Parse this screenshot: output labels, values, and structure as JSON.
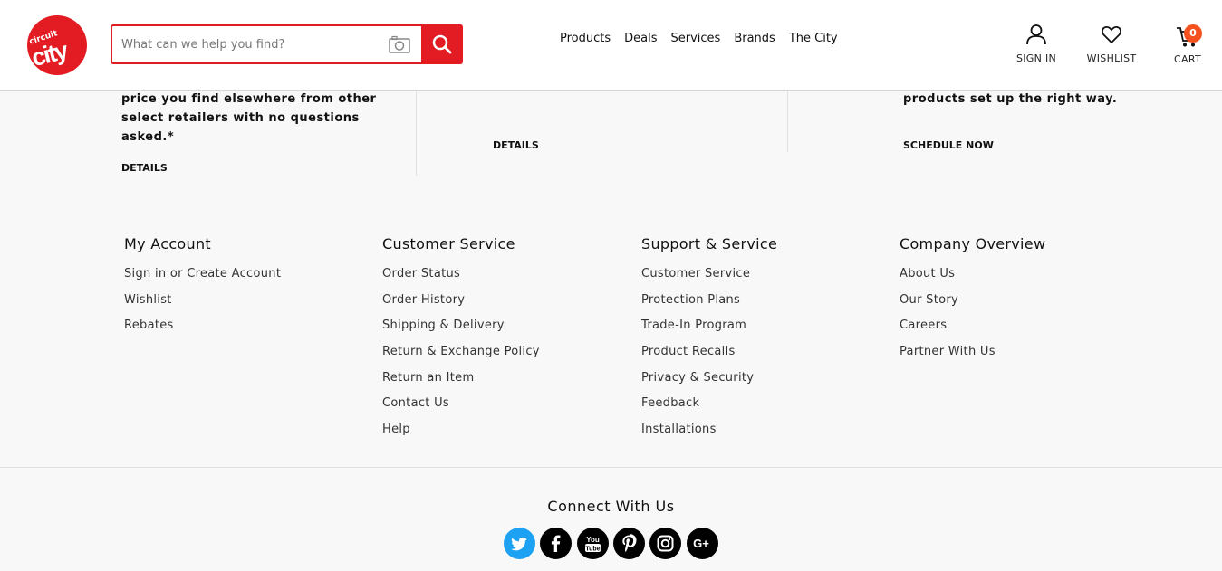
{
  "header": {
    "logo_top": "circuit",
    "logo_main": "city",
    "search_placeholder": "What can we help you find?",
    "nav": [
      "Products",
      "Deals",
      "Services",
      "Brands",
      "The City"
    ],
    "signin_label": "SIGN IN",
    "wishlist_label": "WISHLIST",
    "cart_label": "CART",
    "cart_count": "0"
  },
  "promos": [
    {
      "text_lines": [
        "price you find elsewhere from other",
        "select retailers with no questions",
        "asked.*"
      ],
      "link": "DETAILS"
    },
    {
      "text_lines": [],
      "link": "DETAILS"
    },
    {
      "text_lines": [
        "products set up the right way."
      ],
      "link": "SCHEDULE NOW"
    }
  ],
  "footer": {
    "columns": [
      {
        "title": "My Account",
        "items": [
          "Sign in or Create Account",
          "Wishlist",
          "Rebates"
        ]
      },
      {
        "title": "Customer Service",
        "items": [
          "Order Status",
          "Order History",
          "Shipping & Delivery",
          "Return & Exchange Policy",
          "Return an Item",
          "Contact Us",
          "Help"
        ]
      },
      {
        "title": "Support & Service",
        "items": [
          "Customer Service",
          "Protection Plans",
          "Trade-In Program",
          "Product Recalls",
          "Privacy & Security",
          "Feedback",
          "Installations"
        ]
      },
      {
        "title": "Company Overview",
        "items": [
          "About Us",
          "Our Story",
          "Careers",
          "Partner With Us"
        ]
      }
    ],
    "connect_title": "Connect With Us",
    "social": [
      {
        "name": "twitter-icon",
        "color": "#1da1f2"
      },
      {
        "name": "facebook-icon",
        "color": "#000000"
      },
      {
        "name": "youtube-icon",
        "color": "#000000"
      },
      {
        "name": "pinterest-icon",
        "color": "#000000"
      },
      {
        "name": "instagram-icon",
        "color": "#000000"
      },
      {
        "name": "google-plus-icon",
        "color": "#000000"
      }
    ]
  },
  "colors": {
    "accent": "#e31b23",
    "badge": "#f4511e"
  }
}
